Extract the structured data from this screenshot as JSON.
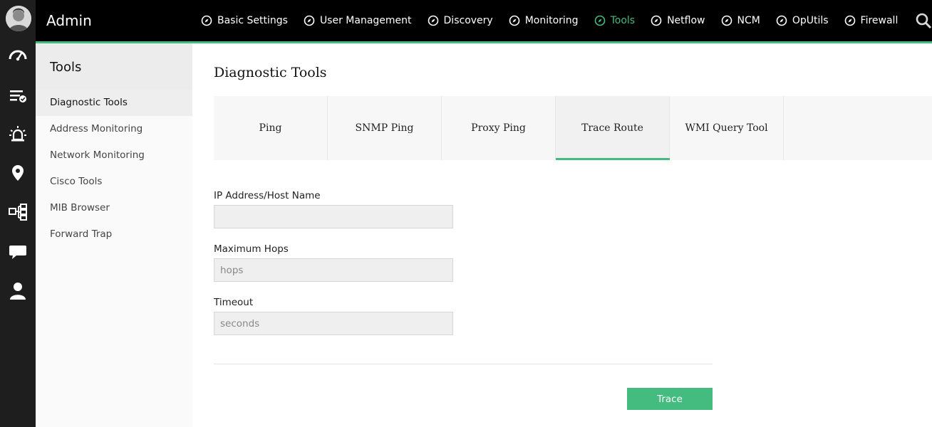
{
  "app": {
    "title": "Admin"
  },
  "nav": {
    "items": [
      {
        "label": "Basic Settings",
        "active": false
      },
      {
        "label": "User Management",
        "active": false
      },
      {
        "label": "Discovery",
        "active": false
      },
      {
        "label": "Monitoring",
        "active": false
      },
      {
        "label": "Tools",
        "active": true
      },
      {
        "label": "Netflow",
        "active": false
      },
      {
        "label": "NCM",
        "active": false
      },
      {
        "label": "OpUtils",
        "active": false
      },
      {
        "label": "Firewall",
        "active": false
      }
    ],
    "search_icon": "search-icon"
  },
  "rail": {
    "icons": [
      "dashboard-icon",
      "alarms-list-icon",
      "alert-siren-icon",
      "map-pin-icon",
      "network-map-icon",
      "chat-icon",
      "user-icon"
    ]
  },
  "sidebar": {
    "title": "Tools",
    "items": [
      {
        "label": "Diagnostic Tools",
        "active": true
      },
      {
        "label": "Address Monitoring",
        "active": false
      },
      {
        "label": "Network Monitoring",
        "active": false
      },
      {
        "label": "Cisco Tools",
        "active": false
      },
      {
        "label": "MIB Browser",
        "active": false
      },
      {
        "label": "Forward Trap",
        "active": false
      }
    ]
  },
  "main": {
    "title": "Diagnostic Tools",
    "tabs": [
      {
        "label": "Ping",
        "active": false
      },
      {
        "label": "SNMP Ping",
        "active": false
      },
      {
        "label": "Proxy Ping",
        "active": false
      },
      {
        "label": "Trace Route",
        "active": true
      },
      {
        "label": "WMI Query Tool",
        "active": false
      }
    ],
    "form": {
      "ip": {
        "label": "IP Address/Host Name",
        "value": "",
        "placeholder": ""
      },
      "hops": {
        "label": "Maximum Hops",
        "value": "",
        "placeholder": "hops"
      },
      "timeout": {
        "label": "Timeout",
        "value": "",
        "placeholder": "seconds"
      }
    },
    "submit_label": "Trace"
  },
  "colors": {
    "accent": "#44bb7f",
    "topbar": "#000000",
    "rail": "#1e1e1e"
  }
}
